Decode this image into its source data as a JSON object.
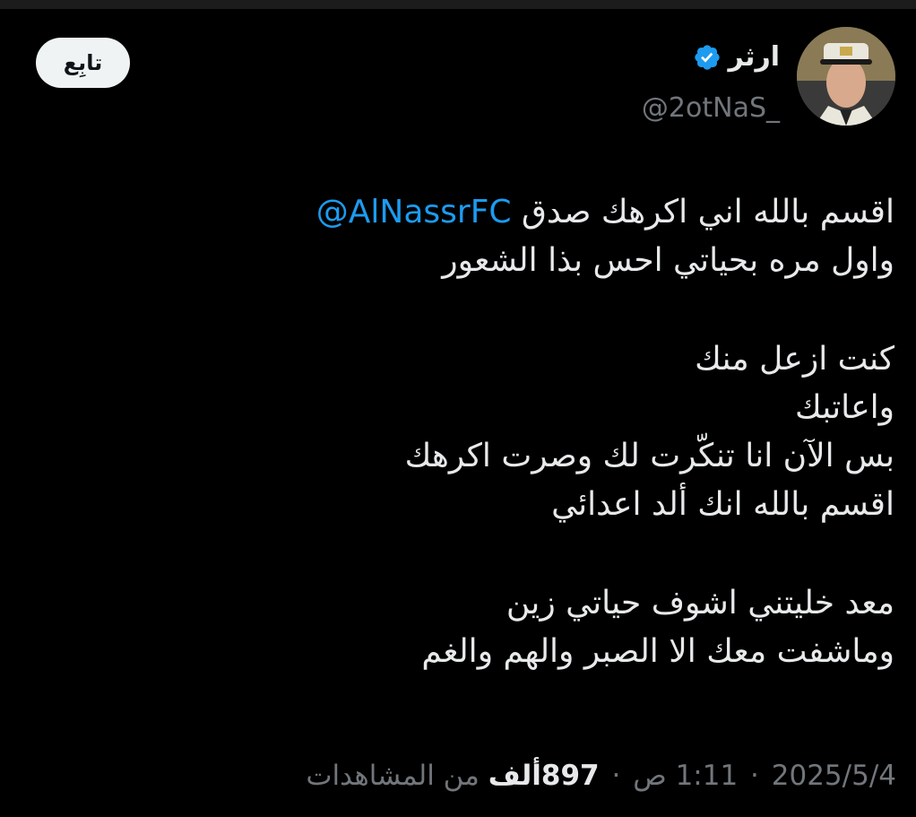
{
  "user": {
    "display_name": "ارثر",
    "handle": "@2otNaS_",
    "verified_icon": "verified-badge-icon",
    "avatar_icon": "profile-avatar-photo"
  },
  "follow_button": {
    "label": "تابِع"
  },
  "tweet": {
    "mention": "@AlNassrFC",
    "lines": [
      "اقسم بالله اني اكرهك صدق",
      "واول مره بحياتي احس بذا الشعور",
      "",
      "كنت ازعل منك",
      "واعاتبك",
      "بس الآن انا تنكّرت لك وصرت اكرهك",
      "اقسم بالله انك ألد اعدائي",
      "",
      "معد خليتني اشوف حياتي زين",
      "وماشفت معك الا الصبر والهم والغم"
    ]
  },
  "meta": {
    "time": "1:11 ص",
    "separator": "·",
    "date": "2025/5/4",
    "views_count": "897ألف",
    "views_label": "من المشاهدات"
  },
  "colors": {
    "background": "#000000",
    "text": "#e7e9ea",
    "secondary": "#71767b",
    "link": "#1d9bf0",
    "verified": "#1d9bf0",
    "follow_bg": "#eff3f4"
  }
}
